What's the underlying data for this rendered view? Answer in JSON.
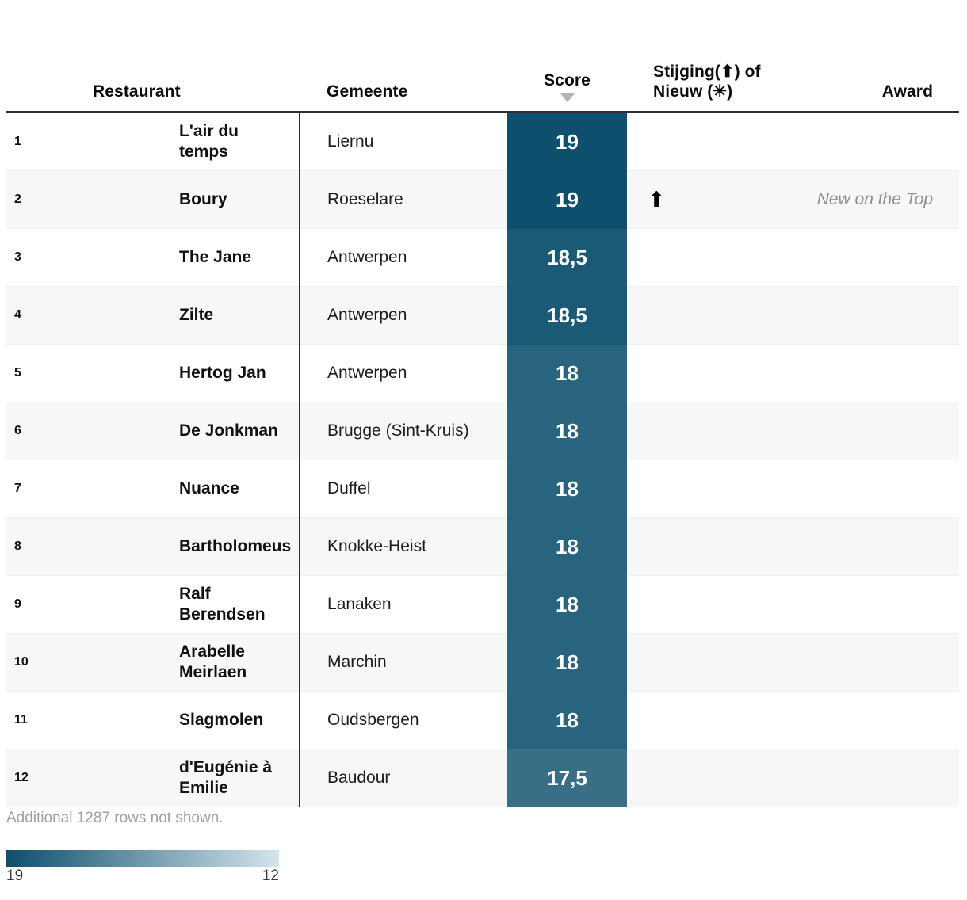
{
  "table": {
    "columns": {
      "rank": "",
      "restaurant": "Restaurant",
      "gemeente": "Gemeente",
      "score": "Score",
      "move": "Stijging(⬆) of Nieuw (✳)",
      "award": "Award"
    },
    "sort": {
      "column": "Score",
      "direction": "descending",
      "icon": "caret-down-icon"
    },
    "rows": [
      {
        "rank": "1",
        "restaurant": "L'air du temps",
        "gemeente": "Liernu",
        "score": "19",
        "score_value": 19,
        "move": "",
        "award": ""
      },
      {
        "rank": "2",
        "restaurant": "Boury",
        "gemeente": "Roeselare",
        "score": "19",
        "score_value": 19,
        "move": "⬆",
        "award": "New on the Top"
      },
      {
        "rank": "3",
        "restaurant": "The Jane",
        "gemeente": "Antwerpen",
        "score": "18,5",
        "score_value": 18.5,
        "move": "",
        "award": ""
      },
      {
        "rank": "4",
        "restaurant": "Zilte",
        "gemeente": "Antwerpen",
        "score": "18,5",
        "score_value": 18.5,
        "move": "",
        "award": ""
      },
      {
        "rank": "5",
        "restaurant": "Hertog Jan",
        "gemeente": "Antwerpen",
        "score": "18",
        "score_value": 18,
        "move": "",
        "award": ""
      },
      {
        "rank": "6",
        "restaurant": "De Jonkman",
        "gemeente": "Brugge (Sint-Kruis)",
        "score": "18",
        "score_value": 18,
        "move": "",
        "award": ""
      },
      {
        "rank": "7",
        "restaurant": "Nuance",
        "gemeente": "Duffel",
        "score": "18",
        "score_value": 18,
        "move": "",
        "award": ""
      },
      {
        "rank": "8",
        "restaurant": "Bartholomeus",
        "gemeente": "Knokke-Heist",
        "score": "18",
        "score_value": 18,
        "move": "",
        "award": ""
      },
      {
        "rank": "9",
        "restaurant": "Ralf Berendsen",
        "gemeente": "Lanaken",
        "score": "18",
        "score_value": 18,
        "move": "",
        "award": ""
      },
      {
        "rank": "10",
        "restaurant": "Arabelle Meirlaen",
        "gemeente": "Marchin",
        "score": "18",
        "score_value": 18,
        "move": "",
        "award": ""
      },
      {
        "rank": "11",
        "restaurant": "Slagmolen",
        "gemeente": "Oudsbergen",
        "score": "18",
        "score_value": 18,
        "move": "",
        "award": ""
      },
      {
        "rank": "12",
        "restaurant": "d'Eugénie à Emilie",
        "gemeente": "Baudour",
        "score": "17,5",
        "score_value": 17.5,
        "move": "",
        "award": ""
      }
    ]
  },
  "footer": {
    "note": "Additional 1287 rows not shown."
  },
  "legend": {
    "min_label": "19",
    "max_label": "12",
    "color_dark": "#0d4f6c",
    "color_light": "#d4e4ec",
    "domain_high": 19,
    "domain_low": 12
  },
  "chart_data": {
    "type": "table",
    "title": "",
    "categories": [
      "L'air du temps",
      "Boury",
      "The Jane",
      "Zilte",
      "Hertog Jan",
      "De Jonkman",
      "Nuance",
      "Bartholomeus",
      "Ralf Berendsen",
      "Arabelle Meirlaen",
      "Slagmolen",
      "d'Eugénie à Emilie"
    ],
    "values": [
      19,
      19,
      18.5,
      18.5,
      18,
      18,
      18,
      18,
      18,
      18,
      18,
      17.5
    ],
    "xlabel": "Restaurant",
    "ylabel": "Score",
    "ylim": [
      12,
      19
    ],
    "legend_position": "bottom-left",
    "color_scale": {
      "type": "sequential",
      "high": "#0d4f6c",
      "low": "#d4e4ec",
      "domain": [
        19,
        12
      ]
    }
  }
}
